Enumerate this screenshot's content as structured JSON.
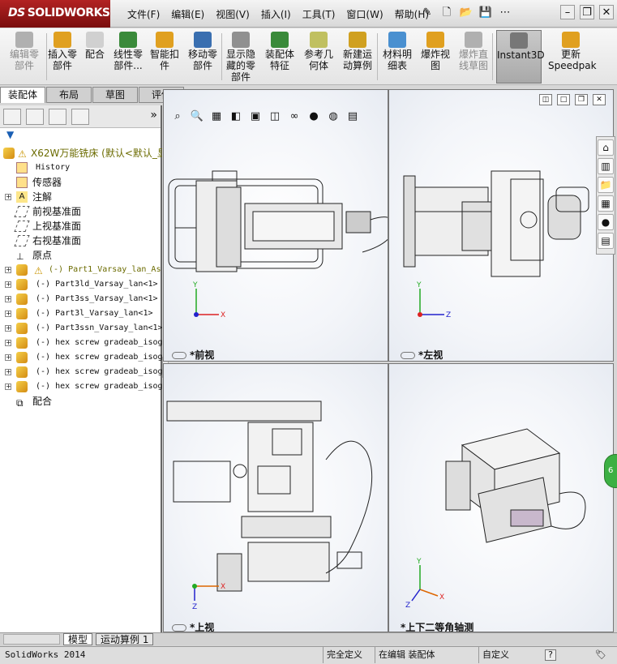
{
  "app": {
    "brand": "SOLIDWORKS",
    "brand_prefix": "DS"
  },
  "menu": [
    "文件(F)",
    "编辑(E)",
    "视图(V)",
    "插入(I)",
    "工具(T)",
    "窗口(W)",
    "帮助(H)"
  ],
  "toolbar": [
    {
      "label": "编辑零\n部件",
      "disabled": true
    },
    {
      "label": "插入零\n部件"
    },
    {
      "label": "配合"
    },
    {
      "label": "线性零\n部件..."
    },
    {
      "label": "智能扣\n件"
    },
    {
      "label": "移动零\n部件"
    },
    {
      "label": "显示隐\n藏的零\n部件"
    },
    {
      "label": "装配体\n特征"
    },
    {
      "label": "参考几\n何体"
    },
    {
      "label": "新建运\n动算例"
    },
    {
      "label": "材料明\n细表"
    },
    {
      "label": "爆炸视\n图"
    },
    {
      "label": "爆炸直\n线草图",
      "disabled": true
    },
    {
      "label": "Instant3D",
      "selected": true
    },
    {
      "label": "更新\nSpeedpak"
    }
  ],
  "tabs": [
    "装配体",
    "布局",
    "草图",
    "评估"
  ],
  "tree": [
    {
      "label": "X62W万能铣床  (默认<默认_显",
      "root": true,
      "warn": true
    },
    {
      "label": "History",
      "mono": true
    },
    {
      "label": "传感器"
    },
    {
      "label": "注解",
      "exp": true
    },
    {
      "label": "前视基准面"
    },
    {
      "label": "上视基准面"
    },
    {
      "label": "右视基准面"
    },
    {
      "label": "原点"
    },
    {
      "label": "(-) Part1_Varsay_lan_As",
      "exp": true,
      "warn": true,
      "mono": true
    },
    {
      "label": "(-) Part3ld_Varsay_lan<1>",
      "exp": true,
      "mono": true
    },
    {
      "label": "(-) Part3ss_Varsay_lan<1>",
      "exp": true,
      "mono": true
    },
    {
      "label": "(-) Part3l_Varsay_lan<1>",
      "exp": true,
      "mono": true
    },
    {
      "label": "(-) Part3ssn_Varsay_lan<1>",
      "exp": true,
      "mono": true
    },
    {
      "label": "(-) hex screw gradeab_isog",
      "exp": true,
      "mono": true
    },
    {
      "label": "(-) hex screw gradeab_isog",
      "exp": true,
      "mono": true
    },
    {
      "label": "(-) hex screw gradeab_isog",
      "exp": true,
      "mono": true
    },
    {
      "label": "(-) hex screw gradeab_isog",
      "exp": true,
      "mono": true
    },
    {
      "label": "配合"
    }
  ],
  "views": {
    "front": "*前视",
    "left": "*左视",
    "top": "*上视",
    "iso": "*上下二等角轴测"
  },
  "bottom_tabs": [
    "模型",
    "运动算例 1"
  ],
  "status": {
    "app": "SolidWorks 2014",
    "define": "完全定义",
    "editing": "在编辑 装配体",
    "custom": "自定义"
  },
  "side_badge": "6"
}
